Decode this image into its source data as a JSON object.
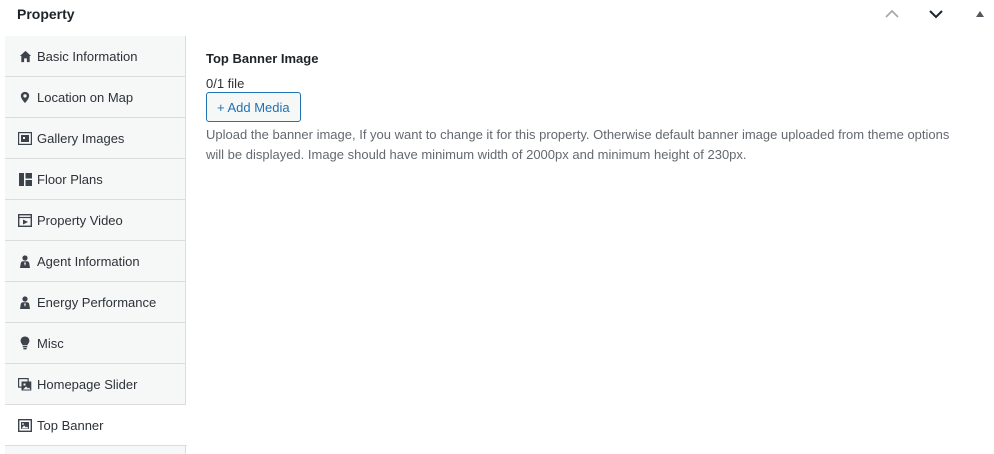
{
  "header": {
    "title": "Property",
    "move_up_icon": "chevron-up-icon",
    "move_down_icon": "chevron-down-icon",
    "toggle_icon": "triangle-up-icon"
  },
  "tabs": [
    {
      "label": "Basic Information",
      "icon": "home-icon"
    },
    {
      "label": "Location on Map",
      "icon": "location-pin-icon"
    },
    {
      "label": "Gallery Images",
      "icon": "gallery-icon"
    },
    {
      "label": "Floor Plans",
      "icon": "layout-icon"
    },
    {
      "label": "Property Video",
      "icon": "video-icon"
    },
    {
      "label": "Agent Information",
      "icon": "businessman-icon"
    },
    {
      "label": "Energy Performance",
      "icon": "businessman-icon"
    },
    {
      "label": "Misc",
      "icon": "lightbulb-icon"
    },
    {
      "label": "Homepage Slider",
      "icon": "images-alt-icon"
    },
    {
      "label": "Top Banner",
      "icon": "image-icon",
      "active": true
    }
  ],
  "field": {
    "title": "Top Banner Image",
    "file_count": "0/1 file",
    "add_media_label": "+ Add Media",
    "description": "Upload the banner image, If you want to change it for this property. Otherwise default banner image uploaded from theme options will be displayed. Image should have minimum width of 2000px and minimum height of 230px."
  },
  "colors": {
    "accent": "#2271b1",
    "tab_bg": "#f6f7f7",
    "border": "#dcdcde",
    "desc_text": "#646970"
  }
}
